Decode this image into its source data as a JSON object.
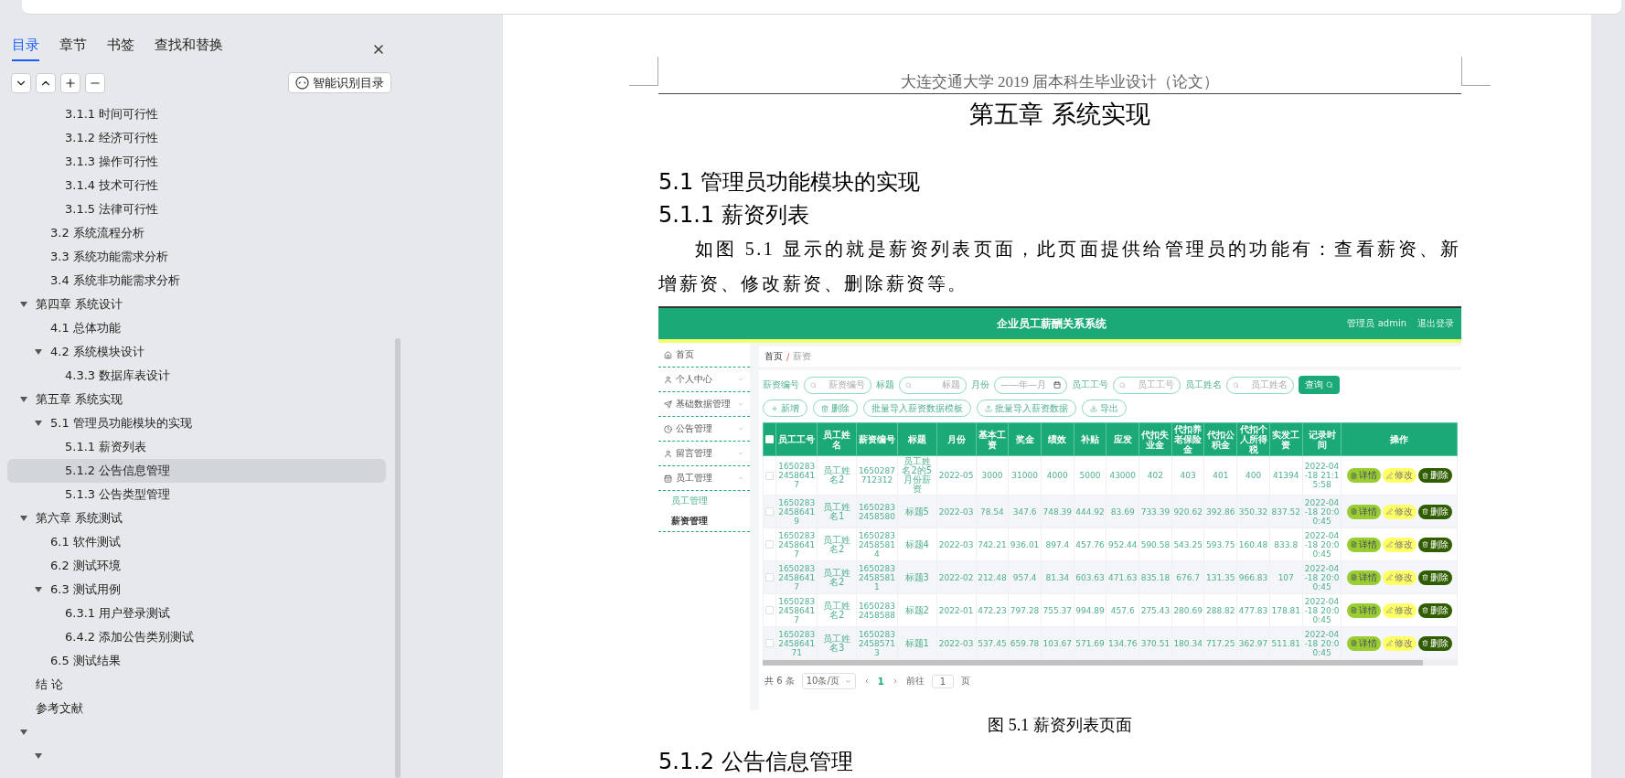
{
  "nav_pane": {
    "tabs": [
      {
        "label": "目录",
        "selected": true
      },
      {
        "label": "章节",
        "selected": false
      },
      {
        "label": "书签",
        "selected": false
      },
      {
        "label": "查找和替换",
        "selected": false
      }
    ],
    "smart_button": "智能识别目录",
    "tree": [
      {
        "children": [
          {
            "children": [
              {
                "label": "3.1.1 时间可行性",
                "selected": false
              },
              {
                "label": "3.1.2  经济可行性",
                "selected": false
              },
              {
                "label": "3.1.3  操作可行性",
                "selected": false
              },
              {
                "label": "3.1.4  技术可行性",
                "selected": false
              },
              {
                "label": "3.1.5  法律可行性",
                "selected": false
              }
            ]
          },
          {
            "label": "3.2 系统流程分析",
            "selected": false
          },
          {
            "label": "3.3 系统功能需求分析",
            "selected": false
          },
          {
            "label": "3.4  系统非功能需求分析",
            "selected": false
          }
        ]
      },
      {
        "label": "第四章  系统设计",
        "selected": false,
        "expanded": true,
        "children": [
          {
            "label": "4.1  总体功能",
            "selected": false
          },
          {
            "label": "4.2  系统模块设计",
            "selected": false,
            "expanded": true,
            "children": [
              {
                "label": "4.3.3  数据库表设计",
                "selected": false
              }
            ]
          }
        ]
      },
      {
        "label": "第五章  系统实现",
        "selected": false,
        "expanded": true,
        "children": [
          {
            "label": "5.1  管理员功能模块的实现",
            "selected": false,
            "expanded": true,
            "children": [
              {
                "label": "5.1.1  薪资列表",
                "selected": false
              },
              {
                "label": "5.1.2  公告信息管理",
                "selected": true
              },
              {
                "label": "5.1.3  公告类型管理",
                "selected": false
              }
            ]
          }
        ]
      },
      {
        "label": "第六章  系统测试",
        "selected": false,
        "expanded": true,
        "children": [
          {
            "label": "6.1 软件测试",
            "selected": false
          },
          {
            "label": "6.2 测试环境",
            "selected": false
          },
          {
            "label": "6.3  测试用例",
            "selected": false,
            "expanded": true,
            "children": [
              {
                "label": "6.3.1  用户登录测试",
                "selected": false
              },
              {
                "label": "6.4.2  添加公告类别测试",
                "selected": false
              }
            ]
          },
          {
            "label": "6.5 测试结果",
            "selected": false
          }
        ]
      },
      {
        "label": "结    论",
        "selected": false
      },
      {
        "label": "参考文献",
        "selected": false
      },
      {
        "selected": false,
        "expanded": true,
        "children": [
          {
            "selected": false,
            "expanded": true
          }
        ]
      }
    ]
  },
  "document": {
    "header": "大连交通大学 2019 届本科生毕业设计（论文）",
    "blocks": [
      {
        "kind": "chapter",
        "text": "第五章  系统实现"
      },
      {
        "kind": "h2",
        "text": "5.1  管理员功能模块的实现"
      },
      {
        "kind": "h3",
        "text": "5.1.1  薪资列表"
      },
      {
        "kind": "paragraph",
        "text": "如图 5.1 显示的就是薪资列表页面，此页面提供给管理员的功能有：查看薪资、新增薪资、修改薪资、删除薪资等。"
      },
      {
        "kind": "figure"
      },
      {
        "kind": "caption",
        "text": "图 5.1  薪资列表页面"
      },
      {
        "kind": "h3",
        "text": "5.1.2  公告信息管理"
      }
    ]
  },
  "app": {
    "title": "企业员工薪酬关系系统",
    "user": "管理员 admin",
    "logout": "退出登录",
    "menu": [
      {
        "kind": "home",
        "label": "首页"
      },
      {
        "kind": "user",
        "label": "个人中心",
        "expanded": false
      },
      {
        "kind": "send",
        "label": "基础数据管理",
        "expanded": false
      },
      {
        "kind": "clock",
        "label": "公告管理",
        "expanded": false
      },
      {
        "kind": "user",
        "label": "留言管理",
        "expanded": false
      },
      {
        "kind": "calendar",
        "label": "员工管理",
        "expanded": true,
        "children": [
          {
            "label": "员工管理",
            "selected": false
          },
          {
            "label": "薪资管理",
            "selected": true
          }
        ]
      }
    ],
    "breadcrumb": [
      "首页",
      "薪资"
    ],
    "breadcrumb_separator": "/",
    "filters": [
      {
        "kind": "text",
        "label": "薪资编号",
        "placeholder": "薪资编号"
      },
      {
        "kind": "text",
        "label": "标题",
        "placeholder": "标题"
      },
      {
        "kind": "month",
        "label": "月份",
        "placeholder": "——年—月"
      },
      {
        "kind": "text",
        "label": "员工工号",
        "placeholder": "员工工号"
      },
      {
        "kind": "text",
        "label": "员工姓名",
        "placeholder": "员工姓名"
      }
    ],
    "search_button": "查询",
    "actions": [
      {
        "kind": "add",
        "label": "新增"
      },
      {
        "kind": "delete",
        "label": "删除"
      },
      {
        "kind": "template",
        "label": "批量导入薪资数据模板"
      },
      {
        "kind": "import",
        "label": "批量导入薪资数据"
      },
      {
        "kind": "export",
        "label": "导出"
      }
    ],
    "header_checked": false,
    "columns": [
      "员工工号",
      "员工姓名",
      "薪资编号",
      "标题",
      "月份",
      "基本工资",
      "奖金",
      "绩效",
      "补贴",
      "应发",
      "代扣失业金",
      "代扣养老保险金",
      "代扣公积金",
      "代扣个人所得税",
      "实发工资",
      "记录时间",
      "操作"
    ],
    "rows": [
      {
        "checked": false,
        "cells": [
          "165028324586417",
          "员工姓名2",
          "1650287712312",
          "员工姓名2的5月份薪资",
          "2022-05",
          "3000",
          "31000",
          "4000",
          "5000",
          "43000",
          "402",
          "403",
          "401",
          "400",
          "41394",
          "2022-04-18 21:15:58"
        ],
        "buttons": [
          {
            "kind": "detail",
            "label": "详情"
          },
          {
            "kind": "edit",
            "label": "修改"
          },
          {
            "kind": "delete",
            "label": "删除"
          }
        ]
      },
      {
        "checked": false,
        "cells": [
          "165028324586419",
          "员工姓名1",
          "16502832458580",
          "标题5",
          "2022-03",
          "78.54",
          "347.6",
          "748.39",
          "444.92",
          "83.69",
          "733.39",
          "920.62",
          "392.86",
          "350.32",
          "837.52",
          "2022-04-18 20:00:45"
        ],
        "buttons": [
          {
            "kind": "detail",
            "label": "详情"
          },
          {
            "kind": "edit",
            "label": "修改"
          },
          {
            "kind": "delete",
            "label": "删除"
          }
        ]
      },
      {
        "checked": false,
        "cells": [
          "165028324586417",
          "员工姓名2",
          "165028324585814",
          "标题4",
          "2022-03",
          "742.21",
          "936.01",
          "897.4",
          "457.76",
          "952.44",
          "590.58",
          "543.25",
          "593.75",
          "160.48",
          "833.8",
          "2022-04-18 20:00:45"
        ],
        "buttons": [
          {
            "kind": "detail",
            "label": "详情"
          },
          {
            "kind": "edit",
            "label": "修改"
          },
          {
            "kind": "delete",
            "label": "删除"
          }
        ]
      },
      {
        "checked": false,
        "cells": [
          "165028324586417",
          "员工姓名2",
          "165028324585811",
          "标题3",
          "2022-02",
          "212.48",
          "957.4",
          "81.34",
          "603.63",
          "471.63",
          "835.18",
          "676.7",
          "131.35",
          "966.83",
          "107",
          "2022-04-18 20:00:45"
        ],
        "buttons": [
          {
            "kind": "detail",
            "label": "详情"
          },
          {
            "kind": "edit",
            "label": "修改"
          },
          {
            "kind": "delete",
            "label": "删除"
          }
        ]
      },
      {
        "checked": false,
        "cells": [
          "165028324586417",
          "员工姓名2",
          "16502832458588",
          "标题2",
          "2022-01",
          "472.23",
          "797.28",
          "755.37",
          "994.89",
          "457.6",
          "275.43",
          "280.69",
          "288.82",
          "477.83",
          "178.81",
          "2022-04-18 20:00:45"
        ],
        "buttons": [
          {
            "kind": "detail",
            "label": "详情"
          },
          {
            "kind": "edit",
            "label": "修改"
          },
          {
            "kind": "delete",
            "label": "删除"
          }
        ]
      },
      {
        "checked": false,
        "cells": [
          "1650283245864171",
          "员工姓名3",
          "165028324585713",
          "标题1",
          "2022-03",
          "537.45",
          "659.78",
          "103.67",
          "571.69",
          "134.76",
          "370.51",
          "180.34",
          "717.25",
          "362.97",
          "511.81",
          "2022-04-18 20:00:45"
        ],
        "buttons": [
          {
            "kind": "detail",
            "label": "详情"
          },
          {
            "kind": "edit",
            "label": "修改"
          },
          {
            "kind": "delete",
            "label": "删除"
          }
        ]
      }
    ],
    "pagination": {
      "total": "共 6 条",
      "page_size": "10条/页",
      "page": "1",
      "goto": "前往",
      "goto_value": "1",
      "suffix": "页"
    }
  }
}
